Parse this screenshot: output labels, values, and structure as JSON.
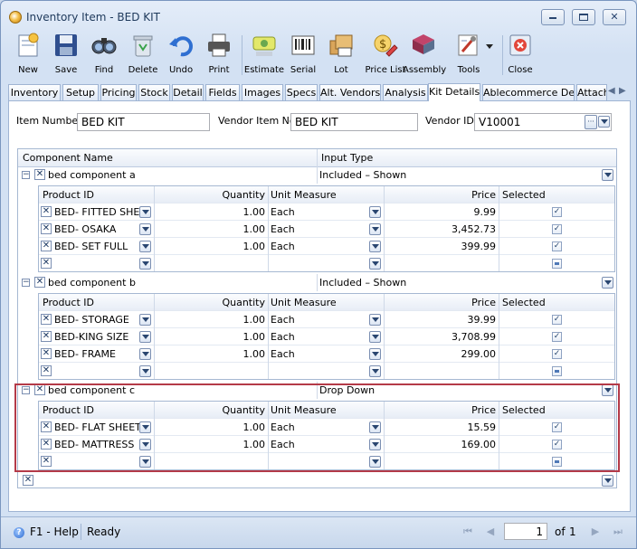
{
  "window": {
    "title": "Inventory Item - BED KIT",
    "minimize_glyph": "─",
    "maximize_glyph": "□",
    "close_glyph": "✕"
  },
  "toolbar": {
    "buttons": [
      {
        "label": "New",
        "icon": "new-icon"
      },
      {
        "label": "Save",
        "icon": "save-icon"
      },
      {
        "label": "Find",
        "icon": "find-icon"
      },
      {
        "label": "Delete",
        "icon": "delete-icon"
      },
      {
        "label": "Undo",
        "icon": "undo-icon"
      },
      {
        "label": "Print",
        "icon": "print-icon"
      },
      {
        "label": "Estimate",
        "icon": "estimate-icon"
      },
      {
        "label": "Serial",
        "icon": "serial-icon"
      },
      {
        "label": "Lot",
        "icon": "lot-icon"
      },
      {
        "label": "Price List",
        "icon": "price-list-icon"
      },
      {
        "label": "Assembly",
        "icon": "assembly-icon"
      },
      {
        "label": "Tools",
        "icon": "tools-icon"
      },
      {
        "label": "Close",
        "icon": "close-doc-icon"
      }
    ]
  },
  "tabs": [
    {
      "label": "Inventory"
    },
    {
      "label": "Setup"
    },
    {
      "label": "Pricing"
    },
    {
      "label": "Stock"
    },
    {
      "label": "Detail"
    },
    {
      "label": "Fields"
    },
    {
      "label": "Images"
    },
    {
      "label": "Specs"
    },
    {
      "label": "Alt. Vendors"
    },
    {
      "label": "Analysis"
    },
    {
      "label": "Kit Details"
    },
    {
      "label": "Ablecommerce Detail"
    },
    {
      "label": "Attach"
    }
  ],
  "active_tab": "Kit Details",
  "form": {
    "item_number_label": "Item Number",
    "item_number_value": "BED KIT",
    "vendor_item_no_label": "Vendor Item No",
    "vendor_item_no_value": "BED KIT",
    "vendor_id_label": "Vendor ID",
    "vendor_id_value": "V10001",
    "ellipsis_glyph": "···"
  },
  "grid": {
    "col_component_name": "Component Name",
    "col_input_type": "Input Type",
    "sub_columns": {
      "product_id": "Product ID",
      "quantity": "Quantity",
      "unit_measure": "Unit Measure",
      "price": "Price",
      "selected": "Selected"
    },
    "glyphs": {
      "remove": "✕",
      "collapse": "−",
      "checked": "✓"
    },
    "components": [
      {
        "name": "bed component a",
        "input_type": "Included – Shown",
        "items": [
          {
            "product_id": "BED- FITTED SHEET",
            "quantity": "1.00",
            "unit": "Each",
            "price": "9.99",
            "selected": true
          },
          {
            "product_id": "BED- OSAKA",
            "quantity": "1.00",
            "unit": "Each",
            "price": "3,452.73",
            "selected": true
          },
          {
            "product_id": "BED- SET FULL",
            "quantity": "1.00",
            "unit": "Each",
            "price": "399.99",
            "selected": true
          }
        ]
      },
      {
        "name": "bed component b",
        "input_type": "Included – Shown",
        "items": [
          {
            "product_id": "BED- STORAGE",
            "quantity": "1.00",
            "unit": "Each",
            "price": "39.99",
            "selected": true
          },
          {
            "product_id": "BED-KING SIZE",
            "quantity": "1.00",
            "unit": "Each",
            "price": "3,708.99",
            "selected": true
          },
          {
            "product_id": "BED- FRAME",
            "quantity": "1.00",
            "unit": "Each",
            "price": "299.00",
            "selected": true
          }
        ]
      },
      {
        "name": "bed component c",
        "input_type": "Drop Down",
        "items": [
          {
            "product_id": "BED- FLAT SHEET",
            "quantity": "1.00",
            "unit": "Each",
            "price": "15.59",
            "selected": true
          },
          {
            "product_id": "BED- MATTRESS",
            "quantity": "1.00",
            "unit": "Each",
            "price": "169.00",
            "selected": true
          }
        ]
      }
    ]
  },
  "status_bar": {
    "help_label": "F1 - Help",
    "help_glyph": "?",
    "status_text": "Ready",
    "page_value": "1",
    "of_label": "of",
    "total_pages": "1",
    "nav_first": "⏮",
    "nav_prev": "◀",
    "nav_next": "▶",
    "nav_last": "⏭"
  },
  "colors": {
    "highlight_border": "#b43a48",
    "accent": "#1e395b"
  }
}
